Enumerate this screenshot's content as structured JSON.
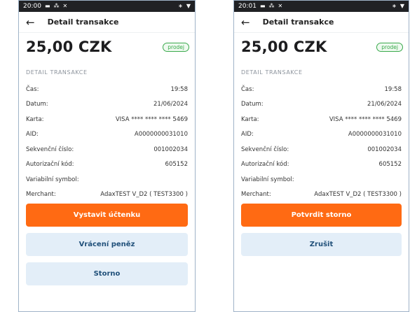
{
  "left": {
    "status": {
      "time": "20:00"
    },
    "header": {
      "title": "Detail transakce",
      "back": "←"
    },
    "amount": "25,00 CZK",
    "badge": "prodej",
    "section": "DETAIL TRANSAKCE",
    "details": [
      {
        "label": "Čas:",
        "value": "19:58"
      },
      {
        "label": "Datum:",
        "value": "21/06/2024"
      },
      {
        "label": "Karta:",
        "value": "VISA **** **** **** 5469"
      },
      {
        "label": "AID:",
        "value": "A0000000031010"
      },
      {
        "label": "Sekvenční číslo:",
        "value": "001002034"
      },
      {
        "label": "Autorizační kód:",
        "value": "605152"
      },
      {
        "label": "Variabilní symbol:",
        "value": ""
      },
      {
        "label": "Merchant:",
        "value": "AdaxTEST V_D2 ( TEST3300 )"
      }
    ],
    "buttons": {
      "receipt": "Vystavit účtenku",
      "refund": "Vrácení peněz",
      "storno": "Storno"
    }
  },
  "right": {
    "status": {
      "time": "20:01"
    },
    "header": {
      "title": "Detail transakce",
      "back": "←"
    },
    "amount": "25,00 CZK",
    "badge": "prodej",
    "section": "DETAIL TRANSAKCE",
    "details": [
      {
        "label": "Čas:",
        "value": "19:58"
      },
      {
        "label": "Datum:",
        "value": "21/06/2024"
      },
      {
        "label": "Karta:",
        "value": "VISA **** **** **** 5469"
      },
      {
        "label": "AID:",
        "value": "A0000000031010"
      },
      {
        "label": "Sekvenční číslo:",
        "value": "001002034"
      },
      {
        "label": "Autorizační kód:",
        "value": "605152"
      },
      {
        "label": "Variabilní symbol:",
        "value": ""
      },
      {
        "label": "Merchant:",
        "value": "AdaxTEST V_D2 ( TEST3300 )"
      }
    ],
    "buttons": {
      "confirm_storno": "Potvrdit storno",
      "cancel": "Zrušit"
    }
  },
  "colors": {
    "accent": "#ff6a13",
    "secondary_bg": "#e3eef8",
    "badge": "#39a94b"
  },
  "icons": [
    "message-icon",
    "network-icon",
    "signal-icon",
    "bluetooth-icon",
    "wifi-icon"
  ]
}
